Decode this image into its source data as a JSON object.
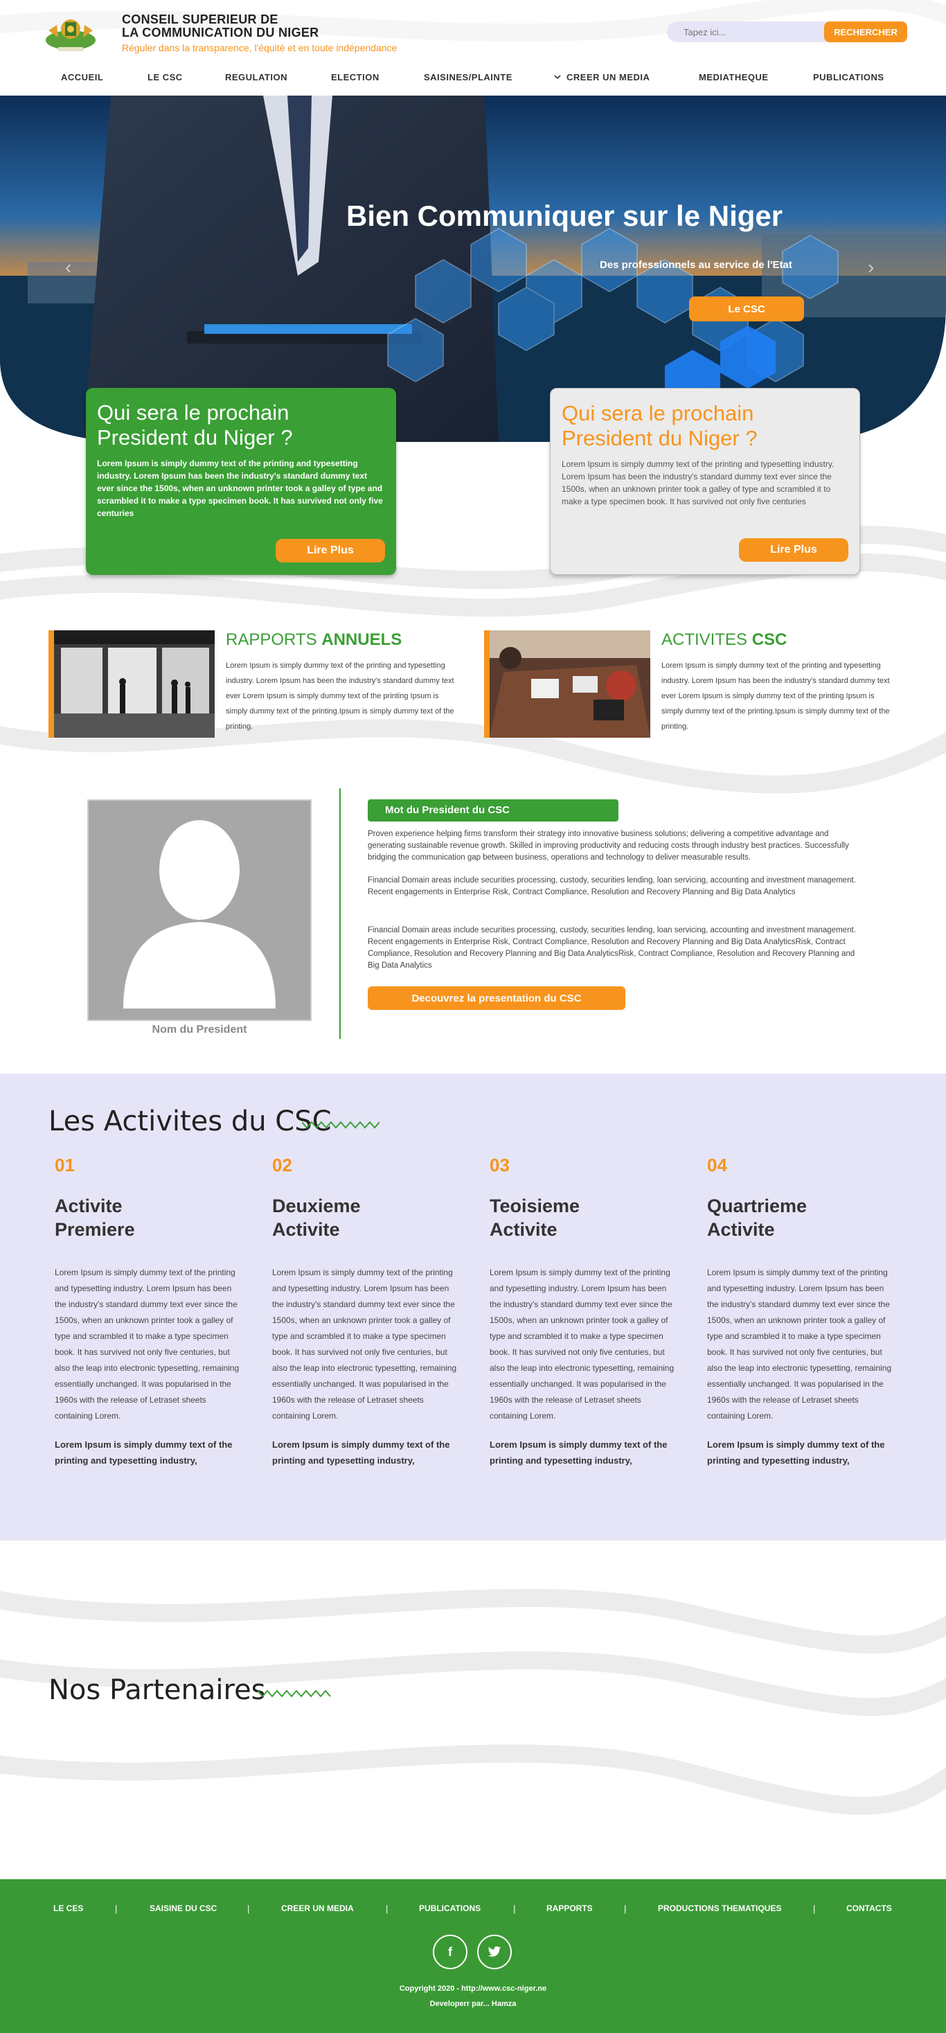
{
  "header": {
    "title_line1": "CONSEIL SUPERIEUR DE",
    "title_line2": "LA COMMUNICATION DU NIGER",
    "tagline": "Réguler dans la transparence, l'équité et en toute indépendance",
    "search_placeholder": "Tapez ici...",
    "search_button": "RECHERCHER"
  },
  "nav": {
    "items": [
      "ACCUEIL",
      "LE CSC",
      "REGULATION",
      "ELECTION",
      "SAISINES/PLAINTE",
      "CREER UN MEDIA",
      "MEDIATHEQUE",
      "PUBLICATIONS"
    ]
  },
  "hero": {
    "title": "Bien Communiquer sur le Niger",
    "subtitle": "Des professionnels au service de l'Etat",
    "button": "Le CSC"
  },
  "cards": [
    {
      "title": "Qui sera le prochain President du Niger ?",
      "text": "Lorem Ipsum is simply dummy text of the printing and typesetting industry. Lorem Ipsum has been the industry's standard dummy text ever since the 1500s, when an unknown printer took a galley of type and scrambled it to make a type specimen book. It has survived not only five centuries",
      "button": "Lire Plus"
    },
    {
      "title": "Qui sera le prochain President du Niger ?",
      "text": "Lorem Ipsum is simply dummy text of the printing and typesetting industry. Lorem Ipsum has been the industry's standard dummy text ever since the 1500s, when an unknown printer took a galley of type and scrambled it to make a type specimen book. It has survived not only five centuries",
      "button": "Lire Plus"
    }
  ],
  "features": [
    {
      "title_light": "RAPPORTS",
      "title_bold": "ANNUELS",
      "text": "Lorem Ipsum is simply dummy text of the printing and typesetting industry. Lorem Ipsum has been the industry's standard dummy text ever Lorem Ipsum is simply dummy text of the printing Ipsum is simply dummy text of the printing.Ipsum is simply dummy text of the printing."
    },
    {
      "title_light": "ACTIVITES",
      "title_bold": "CSC",
      "text": "Lorem Ipsum is simply dummy text of the printing and typesetting industry. Lorem Ipsum has been the industry's standard dummy text ever Lorem Ipsum is simply dummy text of the printing Ipsum is simply dummy text of the printing.Ipsum is simply dummy text of the printing."
    }
  ],
  "president": {
    "name": "Nom du President",
    "label": "Mot du President du CSC",
    "paragraphs": [
      "Proven experience helping firms transform their strategy into innovative business solutions; delivering a competitive advantage and generating sustainable revenue growth. Skilled in improving productivity and reducing costs through industry best practices. Successfully bridging the communication gap between business, operations and technology to deliver measurable results.",
      "Financial Domain areas include securities processing, custody, securities lending, loan servicing, accounting and investment management. Recent engagements in Enterprise Risk, Contract Compliance, Resolution and Recovery Planning and Big Data Analytics",
      "Financial Domain areas include securities processing, custody, securities lending, loan servicing, accounting and investment management. Recent engagements in Enterprise Risk, Contract Compliance, Resolution and Recovery Planning and Big Data AnalyticsRisk, Contract Compliance, Resolution and Recovery Planning and Big Data AnalyticsRisk, Contract Compliance, Resolution and Recovery Planning and Big Data Analytics"
    ],
    "button": "Decouvrez la presentation du CSC"
  },
  "activities": {
    "title": "Les Activites du CSC",
    "items": [
      {
        "num": "01",
        "line1": "Activite",
        "line2": "Premiere"
      },
      {
        "num": "02",
        "line1": "Deuxieme",
        "line2": "Activite"
      },
      {
        "num": "03",
        "line1": "Teoisieme",
        "line2": "Activite"
      },
      {
        "num": "04",
        "line1": "Quartrieme",
        "line2": "Activite"
      }
    ],
    "body": "Lorem Ipsum is simply dummy text of the printing and typesetting industry. Lorem Ipsum has been the industry's standard dummy text ever since the 1500s, when an unknown printer took a galley of type and scrambled it to make a type specimen book. It has survived not only five centuries, but also the leap into electronic typesetting, remaining essentially unchanged. It was popularised in the 1960s with the release of Letraset sheets containing Lorem.",
    "strong": "Lorem Ipsum is simply dummy text of the printing and typesetting industry,"
  },
  "partners": {
    "title": "Nos Partenaires"
  },
  "footer": {
    "links": [
      "LE CES",
      "SAISINE DU CSC",
      "CREER UN MEDIA",
      "PUBLICATIONS",
      "RAPPORTS",
      "PRODUCTIONS THEMATIQUES",
      "CONTACTS"
    ],
    "copyright": "Copyright 2020 - http://www.csc-niger.ne",
    "credit": "Developerr par... Hamza"
  },
  "colors": {
    "green": "#3a9f35",
    "orange": "#f7941d",
    "lavender": "#e6e5f7"
  },
  "icons": [
    "search-icon",
    "chevron-down-icon",
    "chevron-left-icon",
    "chevron-right-icon",
    "facebook-icon",
    "twitter-icon"
  ]
}
